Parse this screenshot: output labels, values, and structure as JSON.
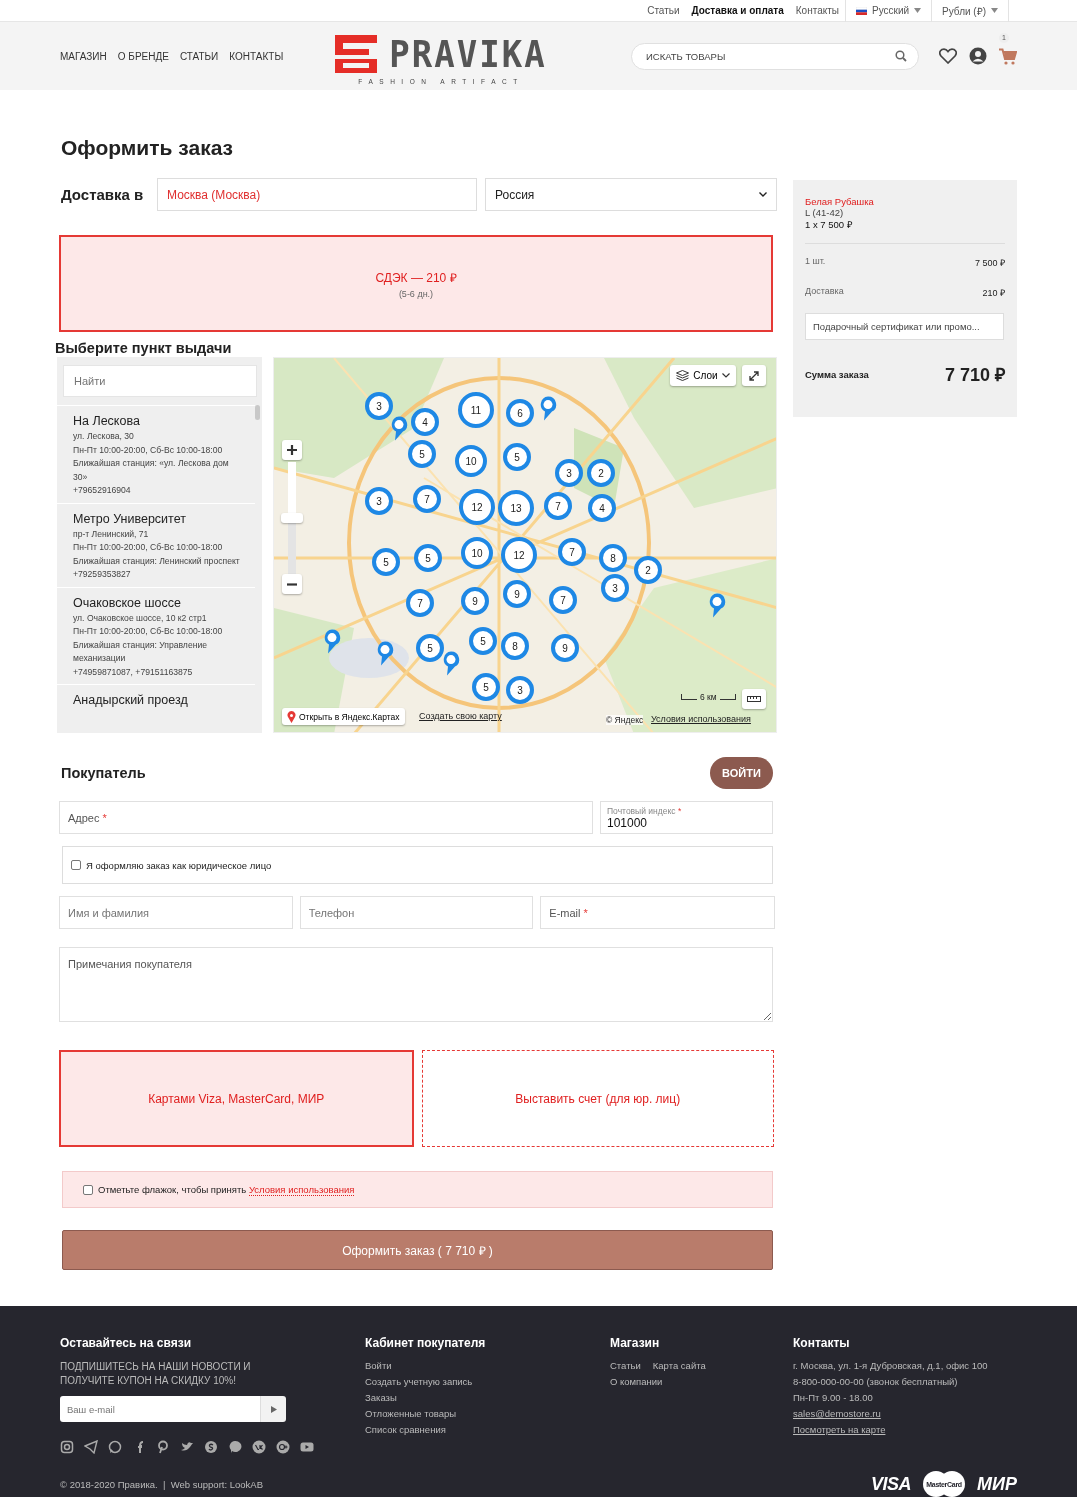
{
  "top_bar": {
    "links": [
      {
        "label": "Статьи",
        "selected": false
      },
      {
        "label": "Доставка и оплата",
        "selected": true
      },
      {
        "label": "Контакты",
        "selected": false
      }
    ],
    "language": "Русский",
    "currency": "Рубли (₽)"
  },
  "header": {
    "nav": [
      "МАГАЗИН",
      "О БРЕНДЕ",
      "СТАТЬИ",
      "КОНТАКТЫ"
    ],
    "logo": {
      "name": "PRAVIKA",
      "tagline": "FASHION ARTIFACT"
    },
    "search": {
      "placeholder": "ИСКАТЬ ТОВАРЫ"
    },
    "cart_count": "1"
  },
  "title": "Оформить заказ",
  "delivery": {
    "label": "Доставка в",
    "city": "Москва (Москва)",
    "country": "Россия",
    "options": [
      {
        "label": "СДЭК — 210 ₽",
        "note": "(5-6 дн.)",
        "selected": true
      }
    ]
  },
  "pickup": {
    "title": "Выберите пункт выдачи",
    "search": {
      "placeholder": "Найти"
    },
    "points": [
      {
        "name": "На Лескова",
        "lines": [
          "ул. Лескова, 30",
          "Пн-Пт 10:00-20:00, Сб-Вс 10:00-18:00",
          "Ближайшая станция: «ул. Лескова дом 30»",
          "+79652916904"
        ]
      },
      {
        "name": "Метро Университет",
        "lines": [
          "пр-т Ленинский, 71",
          "Пн-Пт 10:00-20:00, Сб-Вс 10:00-18:00",
          "Ближайшая станция: Ленинский проспект",
          "+79259353827"
        ]
      },
      {
        "name": "Очаковское шоссе",
        "lines": [
          "ул. Очаковское шоссе, 10 к2 стр1",
          "Пн-Пт 10:00-20:00, Сб-Вс 10:00-18:00",
          "Ближайшая станция: Управление механизации",
          "+74959871087, +79151163875"
        ]
      },
      {
        "name": "Анадырский проезд"
      }
    ],
    "map": {
      "layers_button": "Слои",
      "clusters": [
        "3",
        "4",
        "11",
        "6",
        "5",
        "10",
        "5",
        "3",
        "2",
        "3",
        "7",
        "12",
        "13",
        "7",
        "4",
        "5",
        "5",
        "10",
        "12",
        "7",
        "8",
        "2",
        "3",
        "7",
        "9",
        "9",
        "7",
        "5",
        "5",
        "8",
        "9",
        "5",
        "3"
      ],
      "zoom_slider": {
        "level": 0.5
      },
      "open_link": "Открыть в Яндекс.Картах",
      "create_link": "Создать свою карту",
      "scale": "6 км",
      "copyright": "© Яндекс",
      "terms_link": "Условия использования"
    }
  },
  "buyer": {
    "title": "Покупатель",
    "login_button": "ВОЙТИ",
    "address": {
      "label": "Адрес",
      "required_mark": "*"
    },
    "postcode": {
      "label": "Почтовый индекс",
      "required_mark": "*",
      "value": "101000"
    },
    "legal_entity": {
      "label": "Я оформляю заказ как юридическое лицо",
      "checked": false
    },
    "name": {
      "placeholder": "Имя и фамилия"
    },
    "phone": {
      "placeholder": "Телефон"
    },
    "email": {
      "label": "E-mail",
      "required_mark": "*"
    },
    "notes": {
      "placeholder": "Примечания покупателя"
    }
  },
  "payment": {
    "options": [
      {
        "label": "Картами Viza, MasterCard, МИР",
        "selected": true
      },
      {
        "label": "Выставить счет (для юр. лиц)",
        "selected": false
      }
    ]
  },
  "terms": {
    "text": "Отметьте флажок, чтобы принять ",
    "link": "Условия использования",
    "checked": false
  },
  "submit": "Оформить заказ ( 7 710 ₽ )",
  "summary": {
    "product": "Белая Рубашка",
    "variant": "L (41-42)",
    "qty_price": "1 x 7 500 ₽",
    "lines": [
      {
        "label": "1 шт.",
        "value": "7 500 ₽"
      },
      {
        "label": "Доставка",
        "value": "210 ₽"
      }
    ],
    "promo": {
      "placeholder": "Подарочный сертификат или промо..."
    },
    "total_label": "Сумма заказа",
    "total": "7 710 ₽"
  },
  "footer": {
    "subscribe": {
      "title": "Оставайтесь на связи",
      "text": "ПОДПИШИТЕСЬ НА НАШИ НОВОСТИ И ПОЛУЧИТЕ КУПОН НА СКИДКУ 10%!",
      "placeholder": "Ваш e-mail"
    },
    "account": {
      "title": "Кабинет покупателя",
      "links": [
        "Войти",
        "Создать учетную запись",
        "Заказы",
        "Отложенные товары",
        "Список сравнения"
      ]
    },
    "shop": {
      "title": "Магазин",
      "links": [
        "Статьи",
        "Карта сайта",
        "О компании"
      ]
    },
    "contacts": {
      "title": "Контакты",
      "items": [
        {
          "kind": "text",
          "text": "г. Москва, ул. 1-я Дубровская, д.1, офис 100"
        },
        {
          "kind": "text",
          "text": "8-800-000-00-00 (звонок бесплатный)"
        },
        {
          "kind": "text",
          "text": "Пн-Пт 9.00 - 18.00"
        },
        {
          "kind": "link",
          "text": "sales@demostore.ru"
        },
        {
          "kind": "link",
          "text": "Посмотреть на карте"
        }
      ]
    },
    "copyright": "© 2018-2020 Правика.  |  Web support: LookAB",
    "payment_logos": [
      {
        "kind": "visa",
        "text": "VISA"
      },
      {
        "kind": "mastercard",
        "text": "MasterCard"
      },
      {
        "kind": "mir",
        "text": "МИР"
      }
    ]
  }
}
